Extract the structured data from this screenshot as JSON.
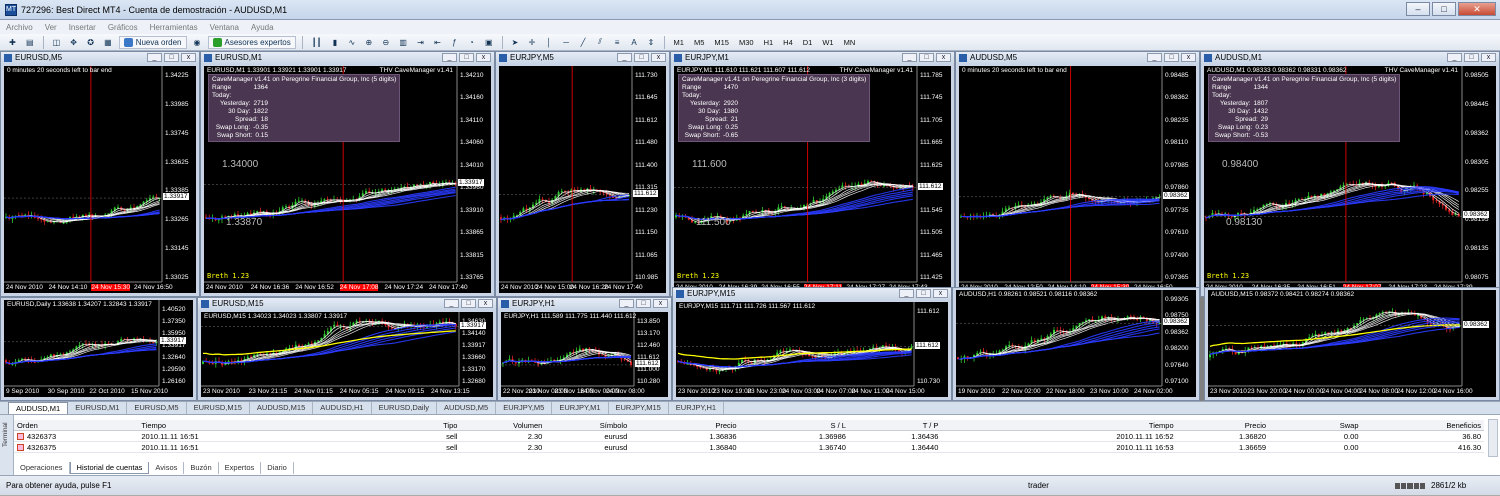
{
  "window": {
    "title": "727296: Best Direct MT4 - Cuenta de demostración - AUDUSD,M1",
    "app_icon_label": "MT",
    "buttons": [
      "–",
      "□",
      "✕"
    ]
  },
  "menu": [
    "Archivo",
    "Ver",
    "Insertar",
    "Gráficos",
    "Herramientas",
    "Ventana",
    "Ayuda"
  ],
  "toolbar": {
    "new_order": "Nueva orden",
    "experts": "Asesores expertos",
    "timeframes": [
      "M1",
      "M5",
      "M15",
      "M30",
      "H1",
      "H4",
      "D1",
      "W1",
      "MN"
    ]
  },
  "charts": [
    {
      "title": "EURUSD,M5",
      "header": "0 minutes 20 seconds left to bar end",
      "prices": [
        "1.34225",
        "1.33985",
        "1.33745",
        "1.33625",
        "1.33385",
        "1.33265",
        "1.33145",
        "1.33025"
      ],
      "current": "1.33917",
      "times": [
        "24 Nov 2010",
        "24 Nov 14:10",
        "24 Nov 15:30",
        "24 Nov 16:50"
      ],
      "highlight": "24 Nov 15:30"
    },
    {
      "title": "EURUSD,M1",
      "header": "EURUSD,M1  1.33901 1.33921 1.33901 1.33917",
      "mgr_title": "THV CaveManager v1.41",
      "mgr_sub": "CaveManager v1.41 on Peregrine Financial Group, Inc (5 digits)",
      "mgr_rows": [
        [
          "Range Today:",
          "1364"
        ],
        [
          "Yesterday:",
          "2719"
        ],
        [
          "30 Day:",
          "1822"
        ],
        [
          "Spread:",
          "18"
        ],
        [
          "Swap Long:",
          "-0.35"
        ],
        [
          "Swap Short:",
          "0.15"
        ]
      ],
      "prices": [
        "1.34210",
        "1.34160",
        "1.34110",
        "1.34060",
        "1.34010",
        "1.33960",
        "1.33910",
        "1.33865",
        "1.33815",
        "1.33765"
      ],
      "current": "1.33917",
      "big_label_1": "1.34000",
      "big_label_2": "1.33870",
      "footer": "Breth 1.23",
      "times": [
        "24 Nov 2010",
        "24 Nov 16:36",
        "24 Nov 16:52",
        "24 Nov 17:08",
        "24 Nov 17:24",
        "24 Nov 17:40"
      ],
      "highlight": "24 Nov 17:08"
    },
    {
      "title": "EURJPY,M5",
      "prices": [
        "111.730",
        "111.645",
        "111.612",
        "111.480",
        "111.400",
        "111.315",
        "111.230",
        "111.150",
        "111.065",
        "110.985"
      ],
      "current": "111.612",
      "times": [
        "24 Nov 2010",
        "24 Nov 15:00",
        "24 Nov 16:20",
        "24 Nov 17:40"
      ],
      "highlight": "24 Nov 15:40"
    },
    {
      "title": "EURJPY,M1",
      "header": "EURJPY,M1  111.610 111.621 111.607 111.612",
      "mgr_title": "THV CaveManager v1.41",
      "mgr_sub": "CaveManager v1.41 on Peregrine Financial Group, Inc (3 digits)",
      "mgr_rows": [
        [
          "Range Today:",
          "1470"
        ],
        [
          "Yesterday:",
          "2920"
        ],
        [
          "30 Day:",
          "1380"
        ],
        [
          "Spread:",
          "21"
        ],
        [
          "Swap Long:",
          "0.25"
        ],
        [
          "Swap Short:",
          "-0.65"
        ]
      ],
      "prices": [
        "111.785",
        "111.745",
        "111.705",
        "111.665",
        "111.625",
        "111.612",
        "111.545",
        "111.505",
        "111.465",
        "111.425"
      ],
      "current": "111.612",
      "big_label_1": "111.600",
      "big_label_2": "111.500",
      "footer": "Breth 1.23",
      "times": [
        "24 Nov 2010",
        "24 Nov 16:39",
        "24 Nov 16:55",
        "24 Nov 17:11",
        "24 Nov 17:27",
        "24 Nov 17:43"
      ],
      "highlight": "24 Nov 17:11"
    },
    {
      "title": "AUDUSD,M5",
      "header": "0 minutes 20 seconds left to bar end",
      "prices": [
        "0.98485",
        "0.98362",
        "0.98235",
        "0.98110",
        "0.97985",
        "0.97860",
        "0.97735",
        "0.97610",
        "0.97490",
        "0.97365"
      ],
      "current": "0.98362",
      "times": [
        "24 Nov 2010",
        "24 Nov 12:50",
        "24 Nov 14:10",
        "24 Nov 15:30",
        "24 Nov 16:50"
      ],
      "highlight": "24 Nov 15:30"
    },
    {
      "title": "AUDUSD,M1",
      "header": "AUDUSD,M1  0.98333 0.98362 0.98331 0.98362",
      "mgr_title": "THV CaveManager v1.41",
      "mgr_sub": "CaveManager v1.41 on Peregrine Financial Group, Inc (5 digits)",
      "mgr_rows": [
        [
          "Range Today:",
          "1344"
        ],
        [
          "Yesterday:",
          "1807"
        ],
        [
          "30 Day:",
          "1432"
        ],
        [
          "Spread:",
          "29"
        ],
        [
          "Swap Long:",
          "0.23"
        ],
        [
          "Swap Short:",
          "-0.53"
        ]
      ],
      "prices": [
        "0.98505",
        "0.98445",
        "0.98362",
        "0.98305",
        "0.98255",
        "0.98195",
        "0.98135",
        "0.98075"
      ],
      "current": "0.98362",
      "big_label_1": "0.98400",
      "big_label_2": "0.98130",
      "footer": "Breth 1.23",
      "times": [
        "24 Nov 2010",
        "24 Nov 16:35",
        "24 Nov 16:51",
        "24 Nov 17:07",
        "24 Nov 17:23",
        "24 Nov 17:39"
      ],
      "highlight": "24 Nov 17:07"
    },
    {
      "title": "EURUSD,Daily",
      "header": "EURUSD,Daily  1.33638 1.34207 1.32843 1.33917",
      "prices": [
        "1.40520",
        "1.37350",
        "1.35950",
        "1.33917",
        "1.32640",
        "1.29590",
        "1.26160"
      ],
      "current": "1.33917",
      "times": [
        "9 Sep 2010",
        "30 Sep 2010",
        "22 Oct 2010",
        "15 Nov 2010"
      ]
    },
    {
      "title": "EURUSD,M15",
      "header": "EURUSD,M15  1.34023 1.34023 1.33807 1.33917",
      "prices": [
        "1.34630",
        "1.34140",
        "1.33917",
        "1.33660",
        "1.33170",
        "1.32680"
      ],
      "current": "1.33917",
      "times": [
        "23 Nov 2010",
        "23 Nov 21:15",
        "24 Nov 01:15",
        "24 Nov 05:15",
        "24 Nov 09:15",
        "24 Nov 13:15"
      ]
    },
    {
      "title": "EURJPY,H1",
      "header": "EURJPY,H1  111.589 111.775 111.440 111.612",
      "prices": [
        "113.850",
        "113.170",
        "112.460",
        "111.612",
        "111.000",
        "110.280"
      ],
      "current": "111.612",
      "times": [
        "22 Nov 2010",
        "23 Nov 08:00",
        "23 Nov 16:00",
        "24 Nov 00:00",
        "24 Nov 08:00"
      ]
    },
    {
      "title": "EURJPY,M15",
      "header": "EURJPY,M15  111.711 111.726 111.567 111.612",
      "prices": [
        "111.612",
        "111.310",
        "110.730"
      ],
      "current": "111.612",
      "times": [
        "23 Nov 2010",
        "23 Nov 19:00",
        "23 Nov 23:00",
        "24 Nov 03:00",
        "24 Nov 07:00",
        "24 Nov 11:00",
        "24 Nov 15:00"
      ]
    },
    {
      "title": "AUDUSD,H1",
      "header": "AUDUSD,H1  0.98261 0.98521 0.98116 0.98362",
      "prices": [
        "0.99305",
        "0.98750",
        "0.98362",
        "0.98200",
        "0.97640",
        "0.97100"
      ],
      "current": "0.98362",
      "times": [
        "19 Nov 2010",
        "22 Nov 02:00",
        "22 Nov 18:00",
        "23 Nov 10:00",
        "24 Nov 02:00"
      ]
    },
    {
      "title": "AUDUSD,M15",
      "header": "AUDUSD,M15  0.98372 0.98421 0.98274 0.98362",
      "prices": [],
      "current": "0.98362",
      "times": [
        "23 Nov 2010",
        "23 Nov 20:00",
        "24 Nov 00:00",
        "24 Nov 04:00",
        "24 Nov 08:00",
        "24 Nov 12:00",
        "24 Nov 16:00"
      ]
    }
  ],
  "chart_tabs": [
    "AUDUSD,M1",
    "EURUSD,M1",
    "EURUSD,M5",
    "EURUSD,M15",
    "AUDUSD,M15",
    "AUDUSD,H1",
    "EURUSD,Daily",
    "AUDUSD,M5",
    "EURJPY,M5",
    "EURJPY,M1",
    "EURJPY,M15",
    "EURJPY,H1"
  ],
  "terminal": {
    "side_label": "Terminal",
    "columns": [
      "Orden",
      "Tiempo",
      "Tipo",
      "Volumen",
      "Símbolo",
      "Precio",
      "S / L",
      "T / P",
      "Tiempo",
      "Precio",
      "Swap",
      "Beneficios"
    ],
    "rows": [
      [
        "4326373",
        "2010.11.11 16:51",
        "sell",
        "2.30",
        "eurusd",
        "1.36836",
        "1.36986",
        "1.36436",
        "2010.11.11 16:52",
        "1.36820",
        "0.00",
        "36.80"
      ],
      [
        "4326375",
        "2010.11.11 16:51",
        "sell",
        "2.30",
        "eurusd",
        "1.36840",
        "1.36740",
        "1.36440",
        "2010.11.11 16:53",
        "1.36659",
        "0.00",
        "416.30"
      ]
    ],
    "tabs": [
      "Operaciones",
      "Historial de cuentas",
      "Avisos",
      "Buzón",
      "Expertos",
      "Diario"
    ]
  },
  "status": {
    "help": "Para obtener ayuda, pulse F1",
    "profile": "trader",
    "traffic": "2861/2 kb"
  },
  "colors": {
    "bull": "#2ecc2e",
    "bear": "#e02020",
    "ma_white": "#ffffff",
    "ma_blue": "#2a3bff",
    "ma_yellow": "#ffff00",
    "highlight": "#ff0000"
  }
}
